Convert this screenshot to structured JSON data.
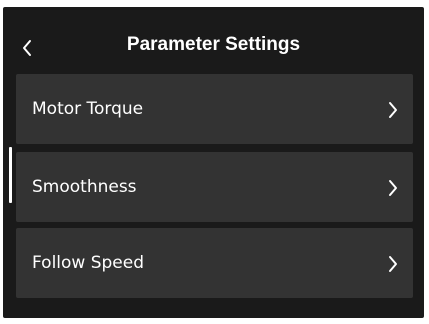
{
  "header": {
    "title": "Parameter Settings",
    "back_icon": "chevron-left-icon"
  },
  "menu": {
    "items": [
      {
        "label": "Motor Torque",
        "icon": "chevron-right-icon"
      },
      {
        "label": "Smoothness",
        "icon": "chevron-right-icon"
      },
      {
        "label": "Follow Speed",
        "icon": "chevron-right-icon"
      }
    ],
    "focused_index": 1
  },
  "colors": {
    "background": "#1a1a1a",
    "item_background": "#333333",
    "text": "#ffffff",
    "focus_indicator": "#ffffff"
  }
}
